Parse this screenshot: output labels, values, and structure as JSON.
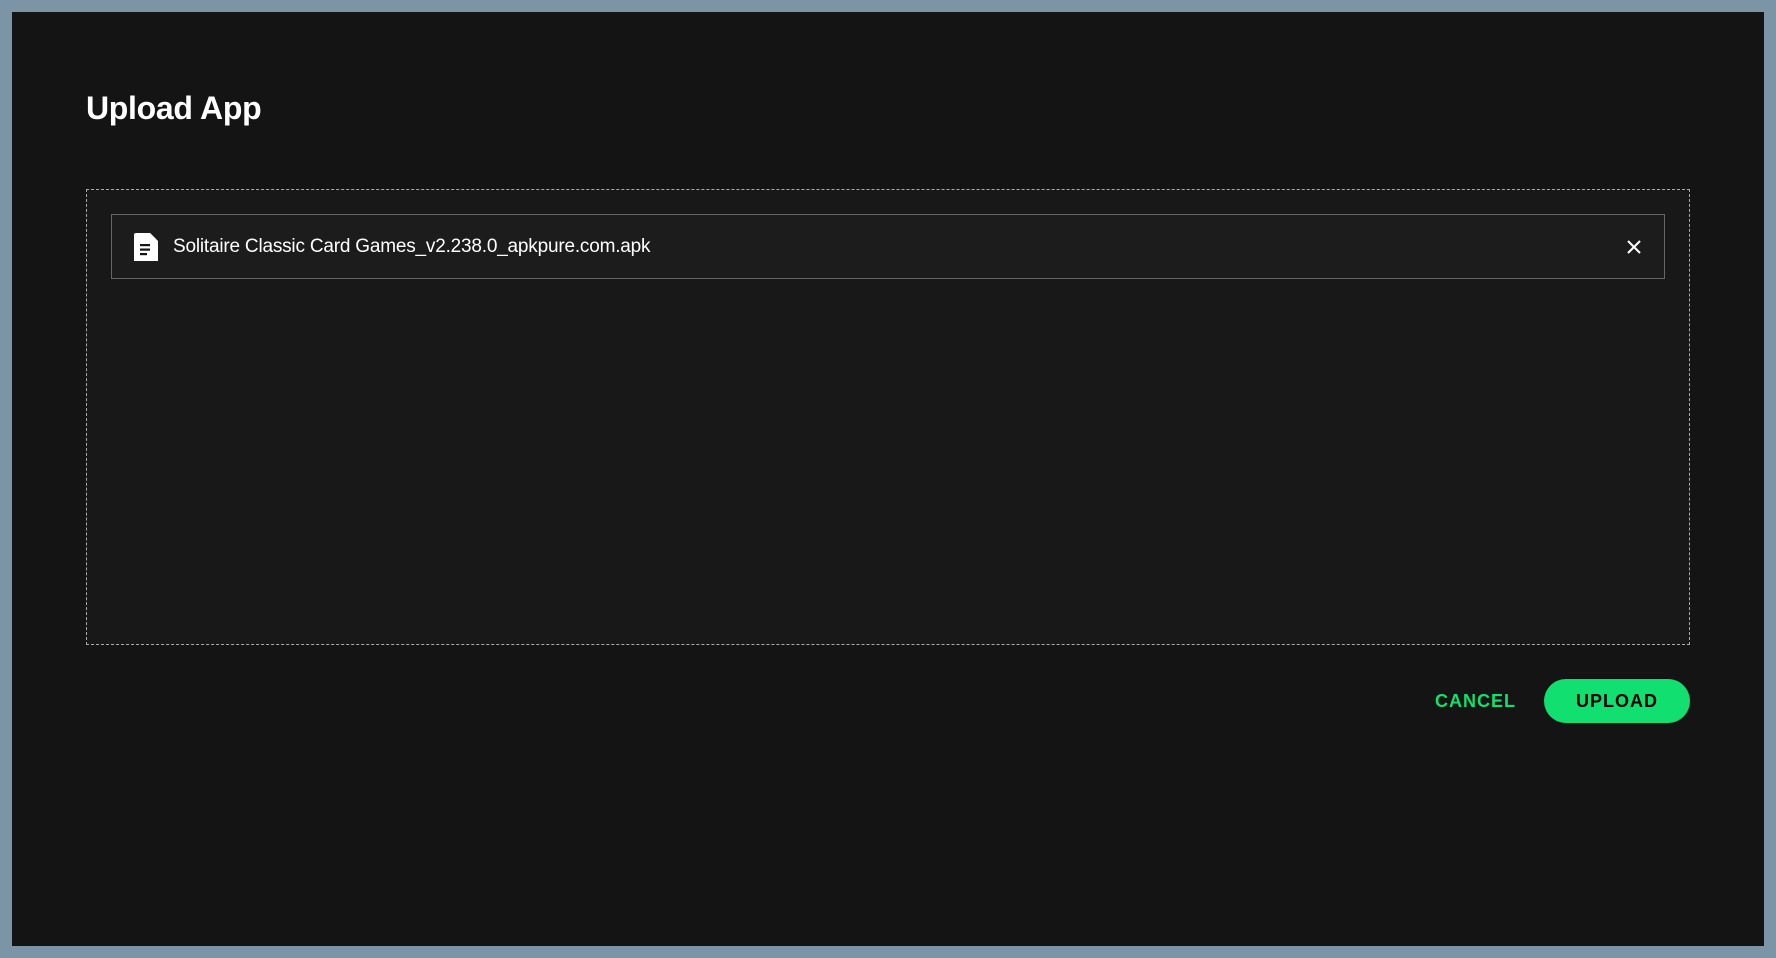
{
  "dialog": {
    "title": "Upload App",
    "file": {
      "name": "Solitaire Classic Card Games_v2.238.0_apkpure.com.apk"
    },
    "actions": {
      "cancel_label": "CANCEL",
      "upload_label": "UPLOAD"
    }
  }
}
